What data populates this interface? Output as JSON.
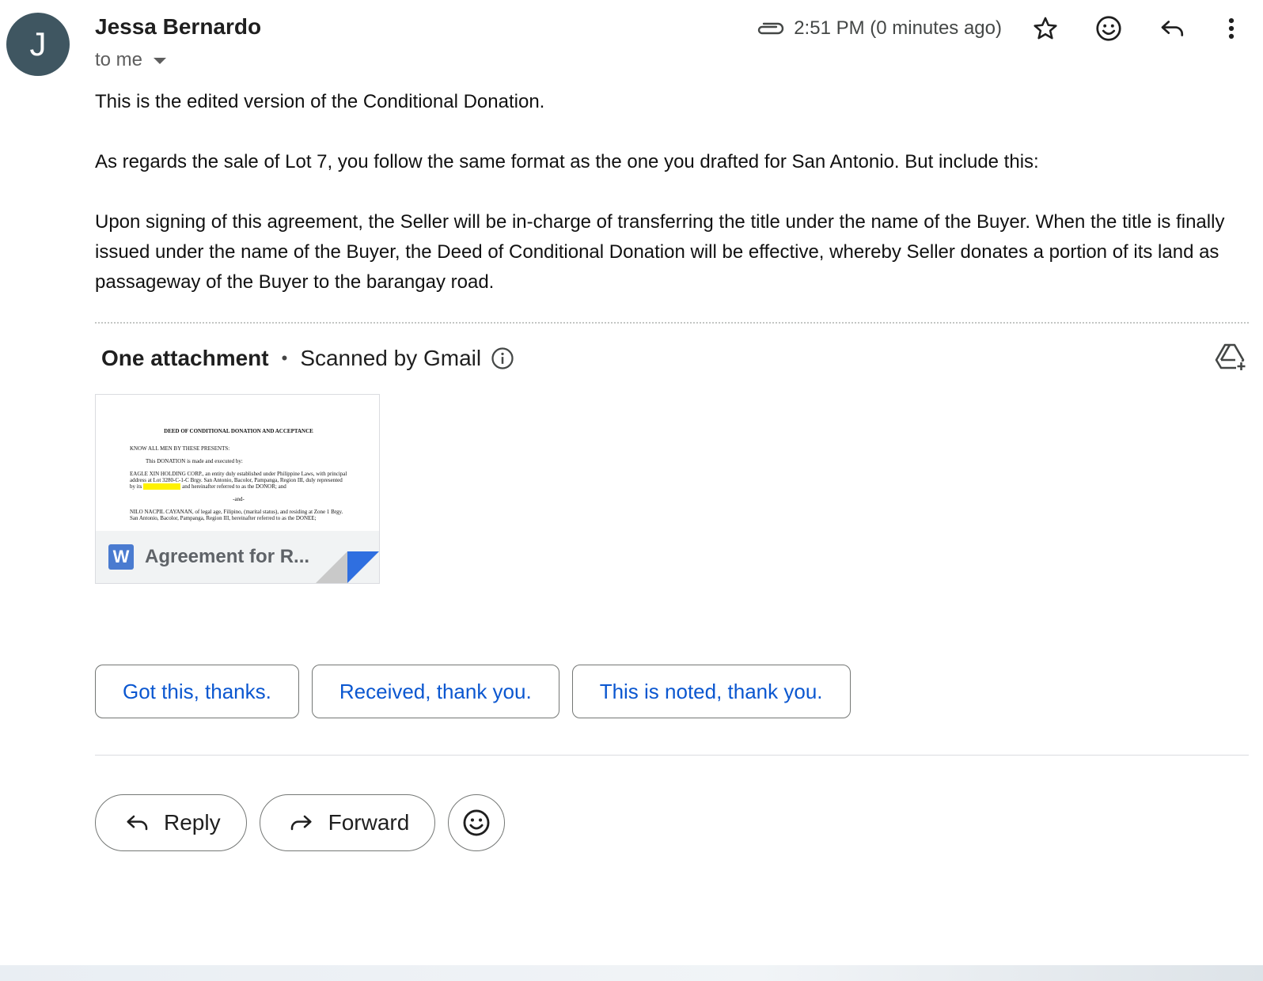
{
  "sender": {
    "avatar_letter": "J",
    "name": "Jessa Bernardo",
    "recipient_label": "to me"
  },
  "header": {
    "timestamp": "2:51 PM (0 minutes ago)",
    "icons": [
      "attachment-icon",
      "star-icon",
      "emoji-icon",
      "reply-icon",
      "more-vert-icon"
    ]
  },
  "message": {
    "paragraphs": [
      "This is the edited version of the Conditional Donation.",
      "As regards the sale of Lot 7, you follow the same format as the one you drafted for San Antonio. But include this:",
      "Upon signing of this agreement, the Seller will be in-charge of transferring the title under the name of the Buyer. When the title is finally issued under the name of the Buyer, the Deed of Conditional Donation will be effective, whereby Seller donates a portion of its land as passageway of the Buyer to the barangay road."
    ]
  },
  "attachments": {
    "count_label": "One attachment",
    "separator": "•",
    "scan_label": "Scanned by Gmail",
    "file": {
      "icon_letter": "W",
      "name": "Agreement for R...",
      "preview": {
        "title": "DEED OF CONDITIONAL DONATION AND ACCEPTANCE",
        "line1": "KNOW ALL MEN BY THESE PRESENTS:",
        "line2": "This DONATION is made and executed by:",
        "line3": "EAGLE XIN HOLDING CORP., an entity duly established under Philippine Laws, with principal address at Lot 3280-C-1-C Brgy. San Antonio, Bacolor, Pampanga, Region III, duly represented by its",
        "line3b": "and hereinafter referred to as the DONOR; and",
        "line4": "-and-",
        "line5": "NILO NACPIL CAYANAN, of legal age, Filipino, (marital status), and residing at Zone 1 Brgy. San Antonio, Bacolor, Pampanga, Region III, hereinafter referred to as the DONEE;"
      }
    }
  },
  "smart_replies": [
    "Got this, thanks.",
    "Received, thank you.",
    "This is noted, thank you."
  ],
  "actions": {
    "reply_label": "Reply",
    "forward_label": "Forward"
  },
  "colors": {
    "avatar_bg": "#3f5661",
    "link_blue": "#0b57d0",
    "word_blue": "#4a7bd0",
    "highlight": "#fff200"
  }
}
